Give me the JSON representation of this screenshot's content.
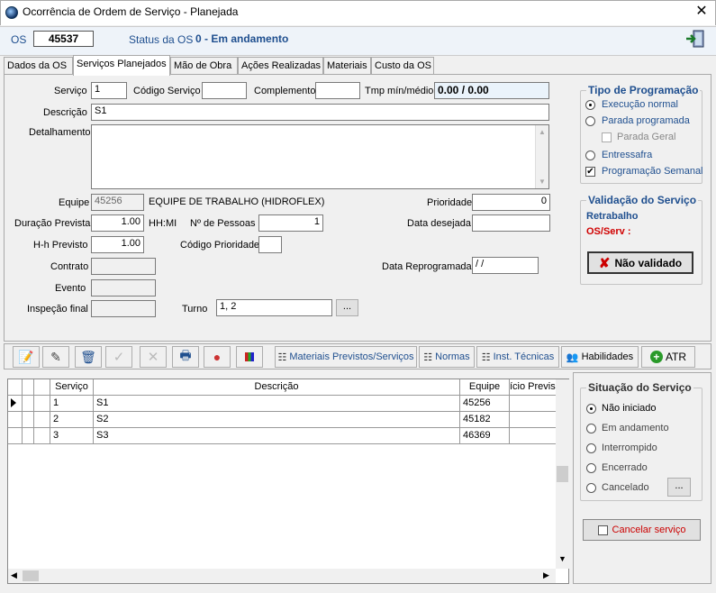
{
  "window": {
    "title": "Ocorrência de Ordem de Serviço - Planejada",
    "close": "✕"
  },
  "header": {
    "os_label": "OS",
    "os_value": "45537",
    "status_label": "Status da OS",
    "status_value": "0 - Em andamento"
  },
  "tabs": [
    "Dados da OS",
    "Serviços Planejados",
    "Mão de Obra",
    "Ações Realizadas",
    "Materiais",
    "Custo da OS"
  ],
  "form": {
    "servico_label": "Serviço",
    "servico_value": "1",
    "codigo_servico_label": "Código Serviço",
    "codigo_servico_value": "",
    "complemento_label": "Complemento",
    "complemento_value": "",
    "tmp_label": "Tmp mín/médio",
    "tmp_value": "0.00 / 0.00",
    "descricao_label": "Descrição",
    "descricao_value": "S1",
    "detalhamento_label": "Detalhamento",
    "detalhamento_value": "",
    "equipe_label": "Equipe",
    "equipe_code": "45256",
    "equipe_name": "EQUIPE DE TRABALHO (HIDROFLEX)",
    "prioridade_label": "Prioridade",
    "prioridade_value": "0",
    "duracao_label": "Duração Prevista",
    "duracao_value": "1.00",
    "duracao_unit": "HH:MI",
    "pessoas_label": "Nº de Pessoas",
    "pessoas_value": "1",
    "data_desejada_label": "Data desejada",
    "data_desejada_value": "",
    "hh_label": "H-h Previsto",
    "hh_value": "1.00",
    "cod_prioridade_label": "Código Prioridade",
    "cod_prioridade_value": "",
    "contrato_label": "Contrato",
    "contrato_value": "",
    "data_reprog_label": "Data Reprogramada",
    "data_reprog_value": " / /",
    "evento_label": "Evento",
    "evento_value": "",
    "inspecao_label": "Inspeção final",
    "inspecao_value": "",
    "turno_label": "Turno",
    "turno_value": "1, 2",
    "turno_btn": "..."
  },
  "tipo_programacao": {
    "title": "Tipo de Programação",
    "exec_normal": "Execução normal",
    "parada_programada": "Parada programada",
    "parada_geral": "Parada Geral",
    "entressafra": "Entressafra",
    "prog_semanal": "Programação Semanal"
  },
  "validacao": {
    "title": "Validação do Serviço",
    "retrabalho": "Retrabalho",
    "os_serv": "OS/Serv :",
    "btn": "Não validado"
  },
  "toolbar": {
    "materiais": "Materiais Previstos/Serviços",
    "normas": "Normas",
    "inst": "Inst. Técnicas",
    "habilidades": "Habilidades",
    "atr": "ATR"
  },
  "grid": {
    "headers": {
      "servico": "Serviço",
      "descricao": "Descrição",
      "equipe": "Equipe",
      "inicio": "ício Previs"
    },
    "rows": [
      {
        "servico": "1",
        "descricao": "S1",
        "equipe": "45256"
      },
      {
        "servico": "2",
        "descricao": "S2",
        "equipe": "45182"
      },
      {
        "servico": "3",
        "descricao": "S3",
        "equipe": "46369"
      }
    ]
  },
  "situacao": {
    "title": "Situação do Serviço",
    "nao_iniciado": "Não iniciado",
    "em_andamento": "Em andamento",
    "interrompido": "Interrompido",
    "encerrado": "Encerrado",
    "cancelado": "Cancelado",
    "btn": "...",
    "cancelar": "Cancelar serviço"
  },
  "colors": {
    "accent_blue": "#1f4f8f",
    "red": "#d00000"
  }
}
